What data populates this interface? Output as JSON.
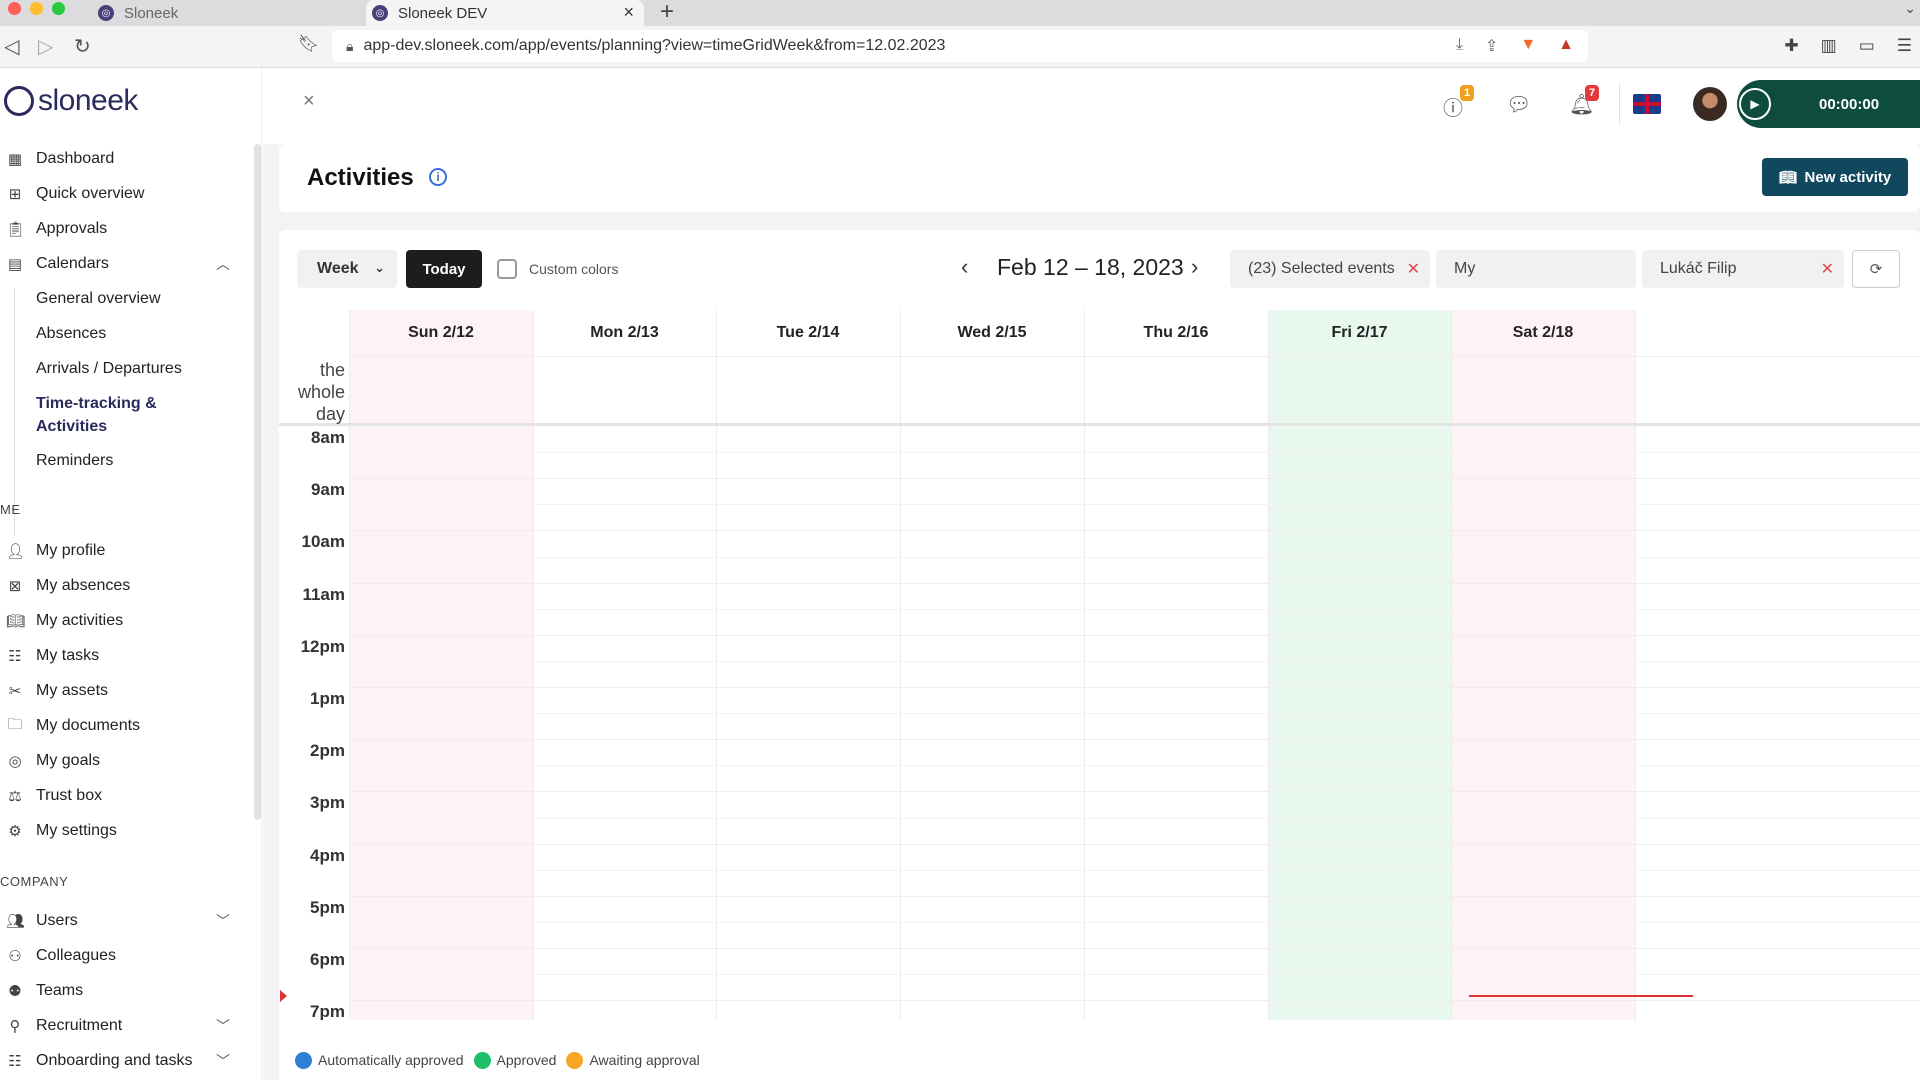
{
  "browser": {
    "tabs": [
      {
        "label": "Sloneek",
        "active": false
      },
      {
        "label": "Sloneek DEV",
        "active": true
      }
    ],
    "url": "app-dev.sloneek.com/app/events/planning?view=timeGridWeek&from=12.02.2023",
    "traffic_colors": [
      "#ff5f57",
      "#febc2e",
      "#28c840"
    ]
  },
  "sidebar": {
    "logo": "sloneek",
    "items": [
      {
        "label": "Dashboard",
        "icon": "dashboard-icon"
      },
      {
        "label": "Quick overview",
        "icon": "grid-icon"
      },
      {
        "label": "Approvals",
        "icon": "clipboard-icon"
      },
      {
        "label": "Calendars",
        "icon": "calendar-icon"
      }
    ],
    "calendar_sub": [
      {
        "label": "General overview"
      },
      {
        "label": "Absences"
      },
      {
        "label": "Arrivals / Departures"
      },
      {
        "label": "Time-tracking &"
      },
      {
        "label": "Activities"
      },
      {
        "label": "Reminders"
      }
    ],
    "me_section": "ME",
    "me_items": [
      {
        "label": "My profile",
        "icon": "user-icon"
      },
      {
        "label": "My absences",
        "icon": "calendar-x-icon"
      },
      {
        "label": "My activities",
        "icon": "book-icon"
      },
      {
        "label": "My tasks",
        "icon": "tasks-icon"
      },
      {
        "label": "My assets",
        "icon": "tools-icon"
      },
      {
        "label": "My documents",
        "icon": "folder-icon"
      },
      {
        "label": "My goals",
        "icon": "target-icon"
      },
      {
        "label": "Trust box",
        "icon": "trust-icon"
      },
      {
        "label": "My settings",
        "icon": "gear-icon"
      }
    ],
    "company_section": "COMPANY",
    "company_items": [
      {
        "label": "Users",
        "icon": "users-icon"
      },
      {
        "label": "Colleagues",
        "icon": "colleagues-icon"
      },
      {
        "label": "Teams",
        "icon": "teams-icon"
      },
      {
        "label": "Recruitment",
        "icon": "recruitment-icon"
      },
      {
        "label": "Onboarding and tasks",
        "icon": "onboarding-icon"
      }
    ]
  },
  "topbar": {
    "alerts_badge": "1",
    "notifications_badge": "7",
    "timer": "00:00:00",
    "badge_colors": {
      "alerts": "#f0a020",
      "notifications": "#e03a3a"
    }
  },
  "header": {
    "title": "Activities",
    "new_activity": "New activity"
  },
  "toolbar": {
    "view": "Week",
    "today": "Today",
    "custom_colors": "Custom colors",
    "date_range": "Feb 12 – 18, 2023",
    "selected_events": "(23) Selected events",
    "scope": "My",
    "person": "Lukáč Filip"
  },
  "calendar": {
    "days": [
      {
        "label": "Sun 2/12"
      },
      {
        "label": "Mon 2/13"
      },
      {
        "label": "Tue 2/14"
      },
      {
        "label": "Wed 2/15"
      },
      {
        "label": "Thu 2/16"
      },
      {
        "label": "Fri 2/17"
      },
      {
        "label": "Sat 2/18"
      }
    ],
    "all_day_label": [
      "the",
      "whole",
      "day"
    ],
    "hours": [
      "8am",
      "9am",
      "10am",
      "11am",
      "12pm",
      "1pm",
      "2pm",
      "3pm",
      "4pm",
      "5pm",
      "6pm",
      "7pm"
    ],
    "weekend_color": "#fdf2f5",
    "today_color": "#e9f8ef",
    "now_line_color": "#dd3333"
  },
  "legend": [
    {
      "label": "Automatically approved",
      "color": "#2f7fd6"
    },
    {
      "label": "Approved",
      "color": "#1fbf6a"
    },
    {
      "label": "Awaiting approval",
      "color": "#f5a623"
    }
  ]
}
